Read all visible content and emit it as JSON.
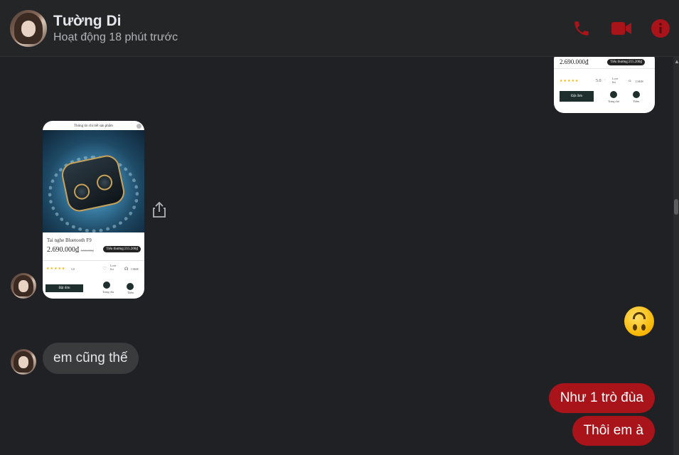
{
  "header": {
    "name": "Tường Di",
    "status": "Hoạt động 18 phút trước",
    "icons": [
      "phone-icon",
      "video-call-icon",
      "info-icon"
    ],
    "accent_color": "#a8141a"
  },
  "top_card": {
    "price": "2.690.000₫",
    "badge": "Tiểu thương:215.200₫",
    "rating": "5.0",
    "love_label": "Love list",
    "chat_label": "CSKH",
    "order_label": "Đặt đơn",
    "store_label": "Trang chủ",
    "more_label": "Thêm"
  },
  "product_card": {
    "title_bar": "Thông tin chi tiết sản phẩm",
    "name": "Tai nghe Bluetooth F9",
    "price": "2.690.000₫",
    "old_price": "3.500.000₫",
    "badge": "Tiểu thương:215.200₫",
    "rating": "5.0",
    "love_label": "Love list",
    "chat_label": "CSKH",
    "order_label": "Đặt đơn",
    "store_label": "Trang chủ",
    "more_label": "Thêm"
  },
  "messages": {
    "incoming_text": "em cũng thế",
    "outgoing_1": "Như 1 trò đùa",
    "outgoing_2": "Thôi em à",
    "emoji": "upside-down-face"
  }
}
